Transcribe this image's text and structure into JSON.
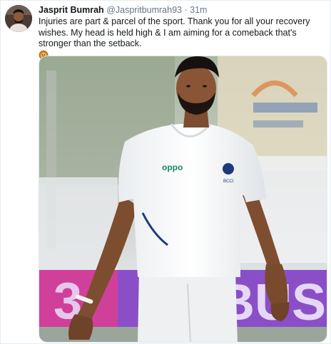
{
  "tweet": {
    "author_name": "Jasprit Bumrah",
    "author_handle": "@Jaspritbumrah93",
    "separator": "·",
    "time": "31m",
    "text": "Injuries are part & parcel of the sport. Thank you for all your recovery wishes. My head is held high & I am aiming for a comeback that's stronger than the setback.",
    "emoji": "lion-face"
  },
  "photo": {
    "shirt_sponsor": "oppo",
    "crest_text": "BCCI",
    "background_banner_text": "BUS",
    "brand_colors": {
      "oppo_green": "#1a8a6a",
      "banner_purple": "#8a4fc7",
      "banner_pink": "#d0409a"
    }
  }
}
